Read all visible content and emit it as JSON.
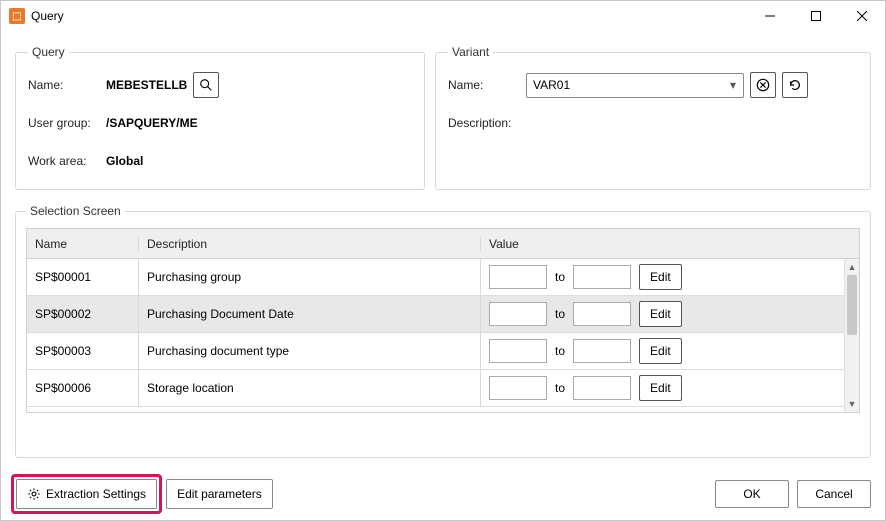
{
  "window": {
    "title": "Query"
  },
  "query": {
    "legend": "Query",
    "name_label": "Name:",
    "name_value": "MEBESTELLB",
    "user_group_label": "User group:",
    "user_group_value": "/SAPQUERY/ME",
    "work_area_label": "Work area:",
    "work_area_value": "Global"
  },
  "variant": {
    "legend": "Variant",
    "name_label": "Name:",
    "name_value": "VAR01",
    "description_label": "Description:",
    "description_value": ""
  },
  "selection": {
    "legend": "Selection Screen",
    "headers": {
      "name": "Name",
      "description": "Description",
      "value": "Value"
    },
    "to_label": "to",
    "edit_label": "Edit",
    "rows": [
      {
        "name": "SP$00001",
        "description": "Purchasing group",
        "selected": false
      },
      {
        "name": "SP$00002",
        "description": "Purchasing Document Date",
        "selected": true
      },
      {
        "name": "SP$00003",
        "description": "Purchasing document type",
        "selected": false
      },
      {
        "name": "SP$00006",
        "description": "Storage location",
        "selected": false
      }
    ]
  },
  "footer": {
    "extraction_label": "Extraction Settings",
    "edit_params_label": "Edit parameters",
    "ok_label": "OK",
    "cancel_label": "Cancel"
  }
}
